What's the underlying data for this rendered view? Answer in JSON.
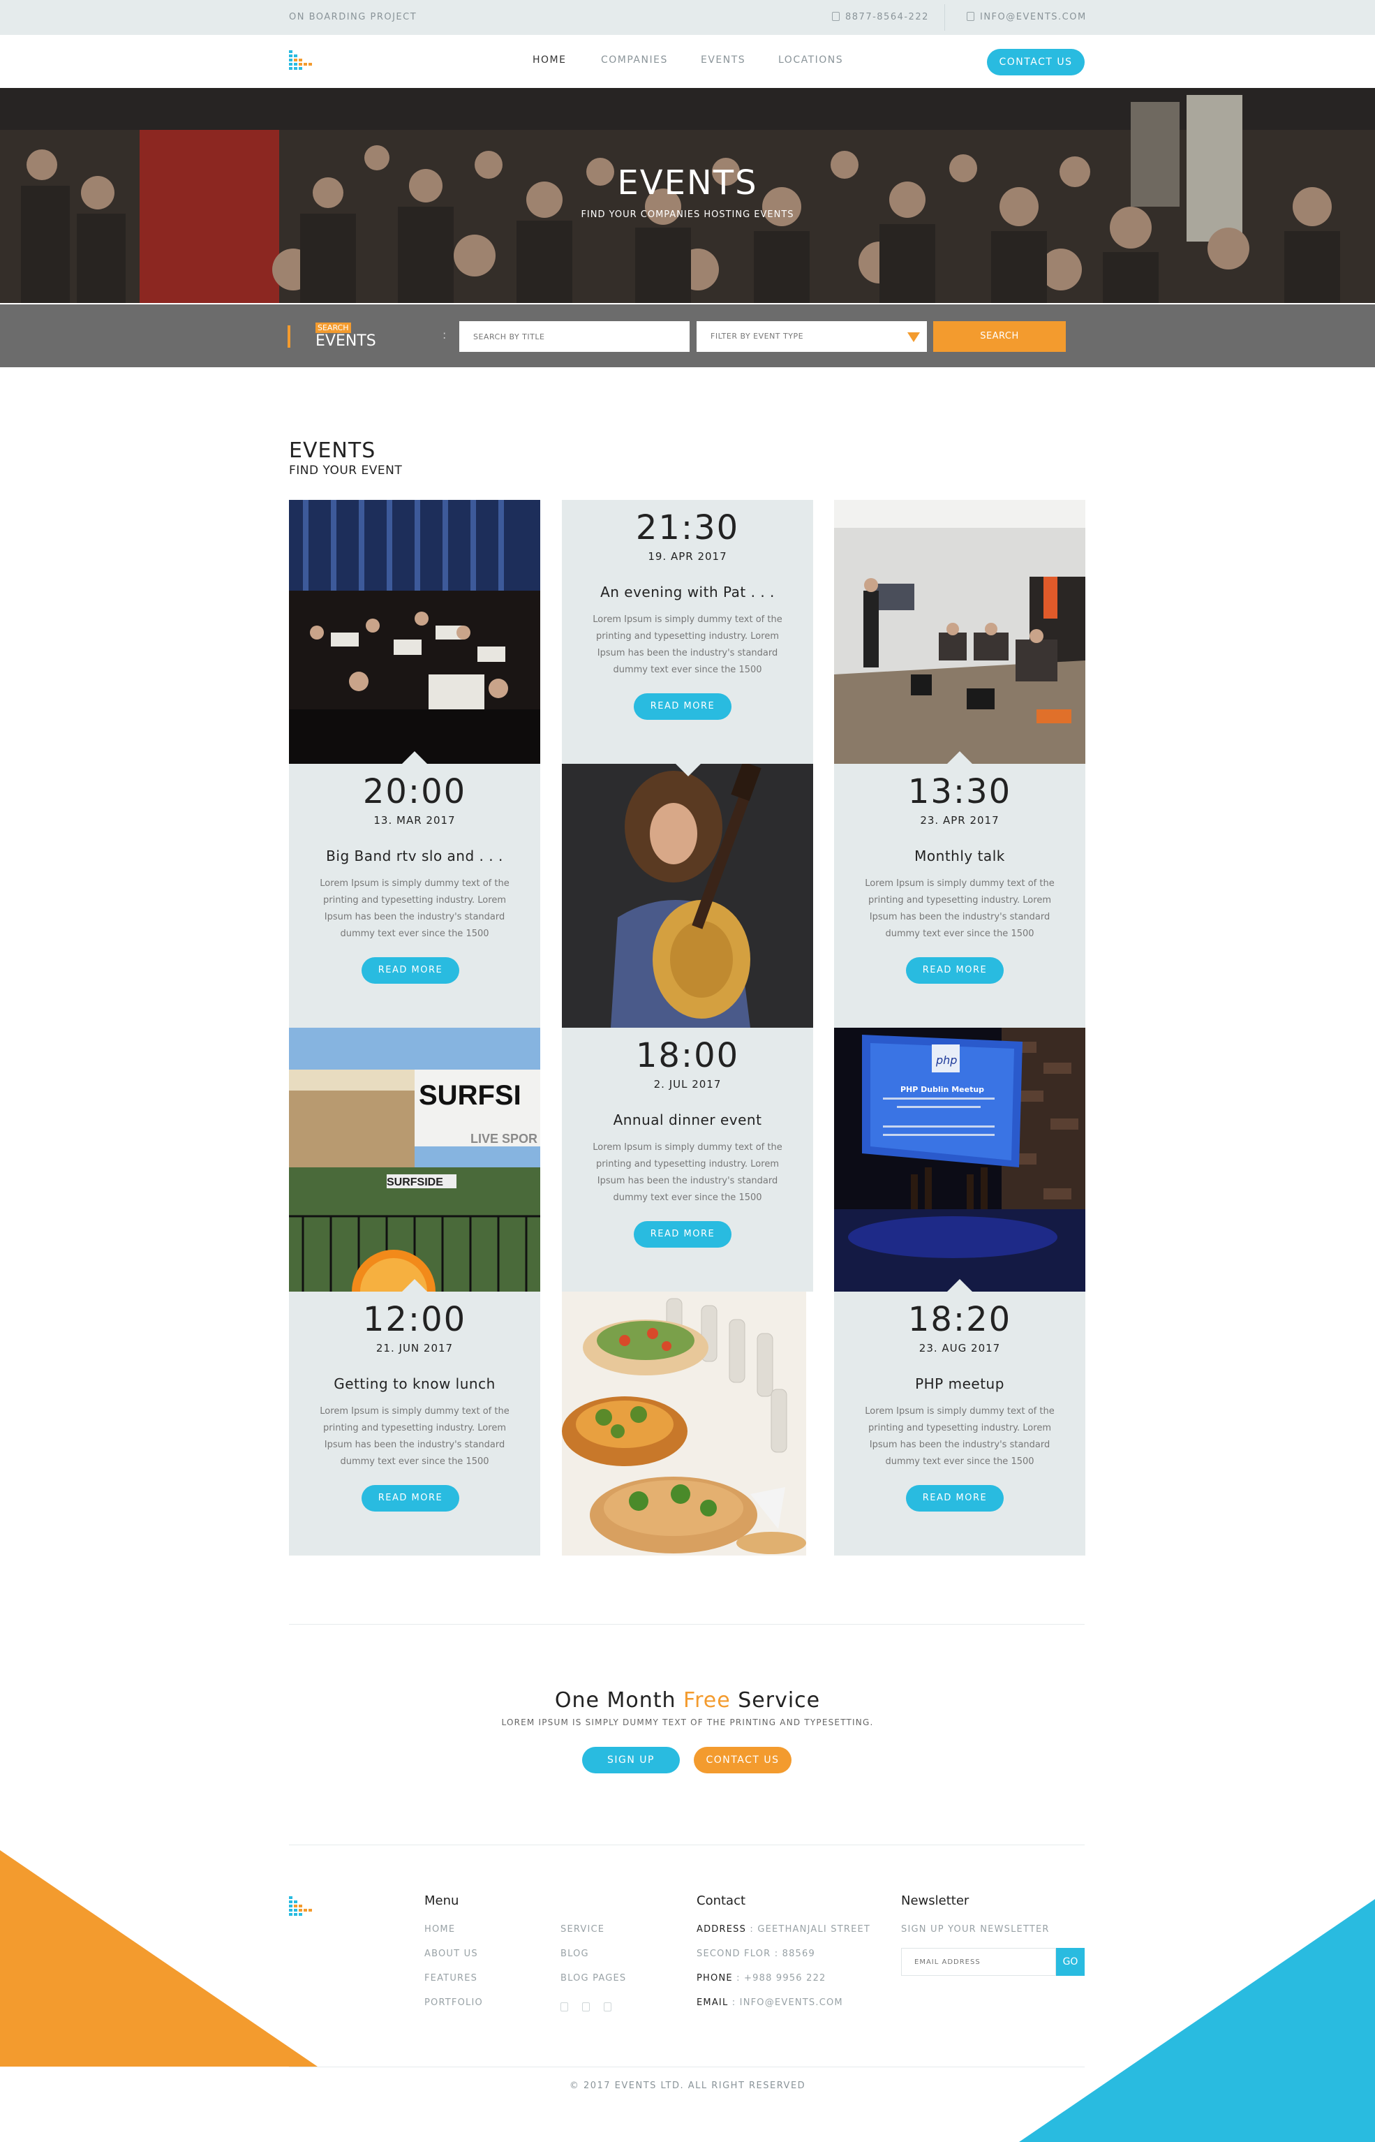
{
  "topbar": {
    "project": "ON BOARDING PROJECT",
    "phone": "8877-8564-222",
    "email": "INFO@EVENTS.COM"
  },
  "nav": {
    "items": [
      "HOME",
      "COMPANIES",
      "EVENTS",
      "LOCATIONS"
    ],
    "active": "HOME",
    "contact_label": "CONTACT US"
  },
  "hero": {
    "title": "EVENTS",
    "subtitle": "FIND YOUR COMPANIES HOSTING EVENTS"
  },
  "search": {
    "tag": "SEARCH",
    "label": "EVENTS",
    "colon": ":",
    "title_placeholder": "SEARCH BY TITLE",
    "filter_placeholder": "FILTER BY EVENT TYPE",
    "button": "SEARCH"
  },
  "section": {
    "title": "EVENTS",
    "subtitle": "FIND YOUR EVENT"
  },
  "events": [
    {
      "time": "21:30",
      "date": "19. APR 2017",
      "title": "An evening with Pat . . .",
      "desc": "Lorem Ipsum is simply dummy text of the printing and typesetting industry. Lorem Ipsum has been the industry's standard dummy text ever since the 1500",
      "button": "READ MORE"
    },
    {
      "time": "20:00",
      "date": "13. MAR 2017",
      "title": "Big Band rtv slo and . . .",
      "desc": "Lorem Ipsum is simply dummy text of the printing and typesetting industry. Lorem Ipsum has been the industry's standard dummy text ever since the 1500",
      "button": "READ MORE"
    },
    {
      "time": "13:30",
      "date": "23. APR 2017",
      "title": "Monthly talk",
      "desc": "Lorem Ipsum is simply dummy text of the printing and typesetting industry. Lorem Ipsum has been the industry's standard dummy text ever since the 1500",
      "button": "READ MORE"
    },
    {
      "time": "18:00",
      "date": "2. JUL 2017",
      "title": "Annual dinner event",
      "desc": "Lorem Ipsum is simply dummy text of the printing and typesetting industry. Lorem Ipsum has been the industry's standard dummy text ever since the 1500",
      "button": "READ MORE"
    },
    {
      "time": "12:00",
      "date": "21. JUN 2017",
      "title": "Getting to know lunch",
      "desc": "Lorem Ipsum is simply dummy text of the printing and typesetting industry. Lorem Ipsum has been the industry's standard dummy text ever since the 1500",
      "button": "READ MORE"
    },
    {
      "time": "18:20",
      "date": "23. AUG 2017",
      "title": "PHP meetup",
      "desc": "Lorem Ipsum is simply dummy text of the printing and typesetting industry. Lorem Ipsum has been the industry's standard dummy text ever since the 1500",
      "button": "READ MORE"
    }
  ],
  "images": {
    "surf_sign": "SURFSI",
    "surf_sub": "LIVE SPOR",
    "surf_side": "SURFSIDE",
    "php_logo": "php",
    "php_title": "PHP Dublin Meetup"
  },
  "promo": {
    "title_a": "One Month ",
    "title_free": "Free",
    "title_b": " Service",
    "subtitle": "LOREM IPSUM IS SIMPLY DUMMY TEXT OF THE PRINTING AND TYPESETTING.",
    "signup": "SIGN UP",
    "contact": "CONTACT US"
  },
  "footer": {
    "menu_title": "Menu",
    "menu_col1": [
      "HOME",
      "ABOUT US",
      "FEATURES",
      "PORTFOLIO"
    ],
    "menu_col2": [
      "SERVICE",
      "BLOG",
      "BLOG PAGES"
    ],
    "contact_title": "Contact",
    "address_label": "ADDRESS",
    "address_value": ": GEETHANJALI STREET",
    "address_line2": "SECOND FLOR : 88569",
    "phone_label": "PHONE",
    "phone_value": ": +988 9956 222",
    "email_label": "EMAIL",
    "email_value": ": INFO@EVENTS.COM",
    "newsletter_title": "Newsletter",
    "newsletter_sub": "SIGN UP YOUR NEWSLETTER",
    "email_placeholder": "EMAIL ADDRESS",
    "go": "GO",
    "copyright": "© 2017 EVENTS LTD. ALL RIGHT RESERVED"
  },
  "colors": {
    "accent_blue": "#29bbe0",
    "accent_orange": "#f39b2e",
    "card_bg": "#e4eaeb",
    "search_bar": "#6c6c6c"
  }
}
